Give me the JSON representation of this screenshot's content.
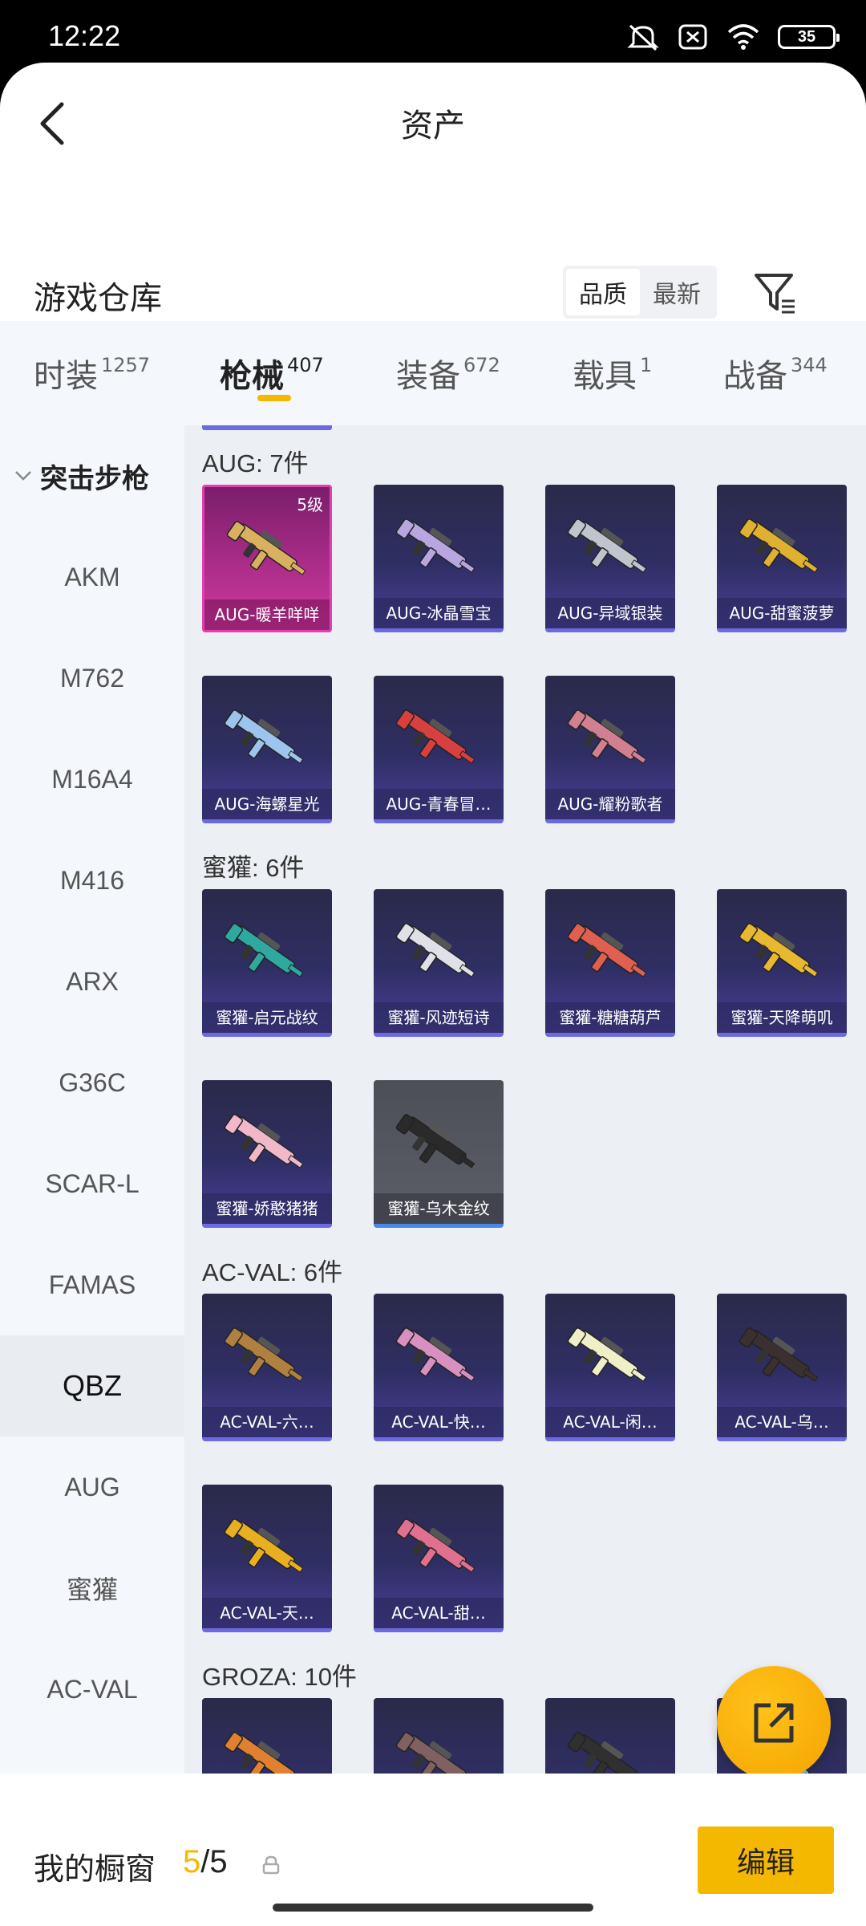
{
  "status_bar": {
    "time": "12:22",
    "battery": "35"
  },
  "header": {
    "title": "资产"
  },
  "section": {
    "title": "游戏仓库"
  },
  "sort": {
    "options": [
      "品质",
      "最新"
    ],
    "active": "品质"
  },
  "tabs": [
    {
      "label": "时装",
      "count": "1257"
    },
    {
      "label": "枪械",
      "count": "407",
      "active": true
    },
    {
      "label": "装备",
      "count": "672"
    },
    {
      "label": "载具",
      "count": "1"
    },
    {
      "label": "战备",
      "count": "344"
    }
  ],
  "sidebar": {
    "group": "突击步枪",
    "items": [
      "AKM",
      "M762",
      "M16A4",
      "M416",
      "ARX",
      "G36C",
      "SCAR-L",
      "FAMAS",
      "QBZ",
      "AUG",
      "蜜獾",
      "AC-VAL"
    ],
    "active": "QBZ"
  },
  "groups": [
    {
      "label": "AUG: 7件",
      "items": [
        {
          "name": "AUG-暖羊咩咩",
          "level": "5级",
          "style": "special",
          "gun": "#d8b060"
        },
        {
          "name": "AUG-冰晶雪宝",
          "gun": "#b8a6e0"
        },
        {
          "name": "AUG-异域银装",
          "gun": "#c0c4cc"
        },
        {
          "name": "AUG-甜蜜菠萝",
          "gun": "#e0b030"
        },
        {
          "name": "AUG-海螺星光",
          "gun": "#9cc4ec"
        },
        {
          "name": "AUG-青春冒…",
          "gun": "#d84040"
        },
        {
          "name": "AUG-耀粉歌者",
          "gun": "#d08090"
        }
      ]
    },
    {
      "label": "蜜獾: 6件",
      "items": [
        {
          "name": "蜜獾-启元战纹",
          "gun": "#2fa8a0"
        },
        {
          "name": "蜜獾-风迹短诗",
          "gun": "#e0e0e8"
        },
        {
          "name": "蜜獾-糖糖葫芦",
          "gun": "#e06050"
        },
        {
          "name": "蜜獾-天降萌叽",
          "gun": "#e8b830"
        },
        {
          "name": "蜜獾-娇憨猪猪",
          "gun": "#f0b8c8"
        },
        {
          "name": "蜜獾-乌木金纹",
          "style": "grey",
          "gun": "#2a2a2a"
        }
      ]
    },
    {
      "label": "AC-VAL: 6件",
      "items": [
        {
          "name": "AC-VAL-六…",
          "gun": "#b08040"
        },
        {
          "name": "AC-VAL-快…",
          "gun": "#d890c0"
        },
        {
          "name": "AC-VAL-闲…",
          "gun": "#f0f0c8"
        },
        {
          "name": "AC-VAL-乌…",
          "gun": "#3a3030"
        },
        {
          "name": "AC-VAL-天…",
          "gun": "#e8b020"
        },
        {
          "name": "AC-VAL-甜…",
          "gun": "#e07090"
        }
      ]
    },
    {
      "label": "GROZA: 10件",
      "items": [
        {
          "name": "",
          "gun": "#e08030"
        },
        {
          "name": "",
          "gun": "#806060"
        },
        {
          "name": "",
          "gun": "#303030"
        },
        {
          "name": "",
          "gun": "#80c0e0"
        }
      ]
    }
  ],
  "showcase": {
    "label": "我的橱窗",
    "current": "5",
    "total": "/5",
    "edit_label": "编辑"
  }
}
